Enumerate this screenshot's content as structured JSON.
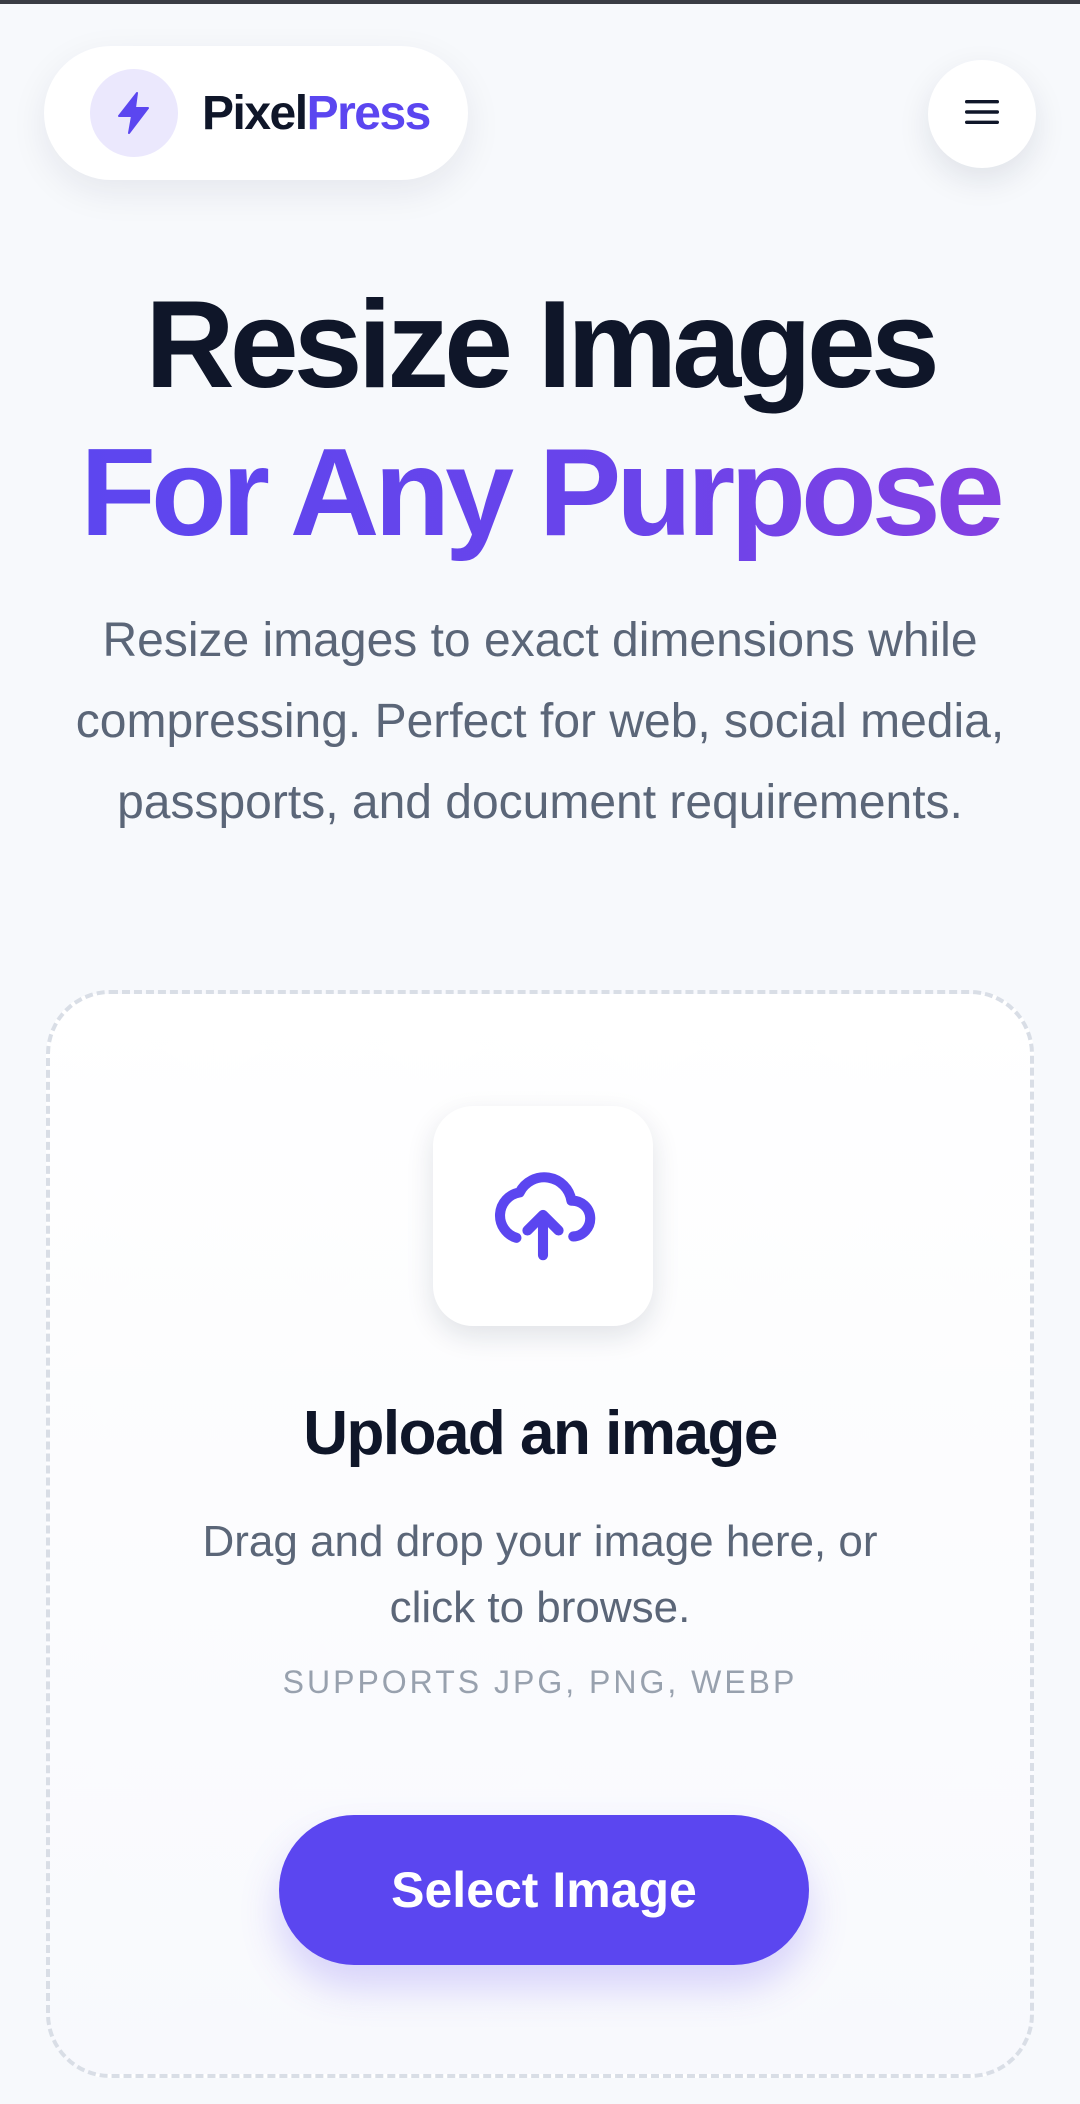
{
  "header": {
    "brand_part1": "Pixel",
    "brand_part2": "Press",
    "logo_icon": "lightning-bolt-icon",
    "menu_icon": "hamburger-menu-icon"
  },
  "hero": {
    "title_line1": "Resize Images",
    "title_line2": "For Any Purpose",
    "subtitle": "Resize images to exact dimensions while compressing. Perfect for web, social media, passports, and document requirements."
  },
  "upload": {
    "icon": "cloud-upload-icon",
    "title": "Upload an image",
    "description": "Drag and drop your image here, or click to browse.",
    "formats": "SUPPORTS JPG, PNG, WEBP",
    "button_label": "Select Image"
  },
  "colors": {
    "accent": "#5b46f0",
    "heading": "#0f1629",
    "body_text": "#5b6678",
    "muted_text": "#98a1ae",
    "background": "#f7f9fc"
  }
}
